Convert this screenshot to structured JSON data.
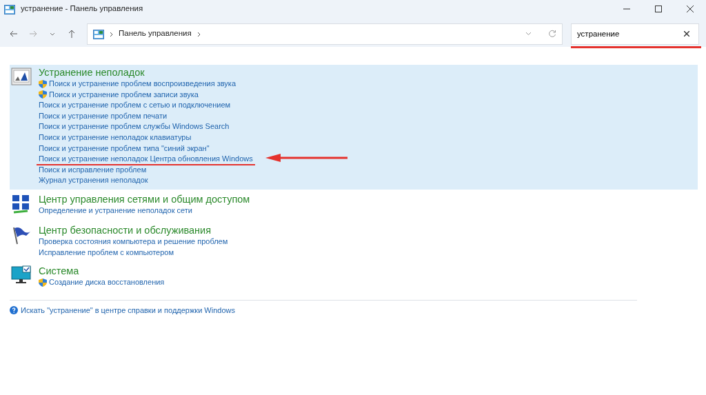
{
  "window": {
    "title": "устранение - Панель управления"
  },
  "breadcrumb": [
    "Панель управления"
  ],
  "search": {
    "value": "устранение",
    "annotated": true
  },
  "groups": [
    {
      "title": "Устранение неполадок",
      "kind": "troubleshoot",
      "selected": true,
      "links": [
        {
          "text": "Поиск и устранение проблем воспроизведения звука",
          "shield": true,
          "annotated": false
        },
        {
          "text": "Поиск и устранение проблем записи звука",
          "shield": true,
          "annotated": false
        },
        {
          "text": "Поиск и устранение проблем с сетью и подключением",
          "shield": false,
          "annotated": false
        },
        {
          "text": "Поиск и устранение проблем печати",
          "shield": false,
          "annotated": false
        },
        {
          "text": "Поиск и устранение проблем службы Windows Search",
          "shield": false,
          "annotated": false
        },
        {
          "text": "Поиск и устранение неполадок клавиатуры",
          "shield": false,
          "annotated": false
        },
        {
          "text": "Поиск и устранение проблем типа \"синий экран\"",
          "shield": false,
          "annotated": false
        },
        {
          "text": "Поиск и устранение неполадок Центра обновления Windows",
          "shield": false,
          "annotated": true
        },
        {
          "text": "Поиск и исправление проблем",
          "shield": false,
          "annotated": false
        },
        {
          "text": "Журнал устранения неполадок",
          "shield": false,
          "annotated": false
        }
      ]
    },
    {
      "title": "Центр управления сетями и общим доступом",
      "kind": "network",
      "selected": false,
      "links": [
        {
          "text": "Определение и устранение неполадок сети",
          "shield": false,
          "annotated": false
        }
      ]
    },
    {
      "title": "Центр безопасности и обслуживания",
      "kind": "flag",
      "selected": false,
      "links": [
        {
          "text": "Проверка состояния компьютера и решение проблем",
          "shield": false,
          "annotated": false
        },
        {
          "text": "Исправление проблем с компьютером",
          "shield": false,
          "annotated": false
        }
      ]
    },
    {
      "title": "Система",
      "kind": "system",
      "selected": false,
      "links": [
        {
          "text": "Создание диска восстановления",
          "shield": true,
          "annotated": false
        }
      ]
    }
  ],
  "help_link": "Искать \"устранение\" в центре справки и поддержки Windows"
}
